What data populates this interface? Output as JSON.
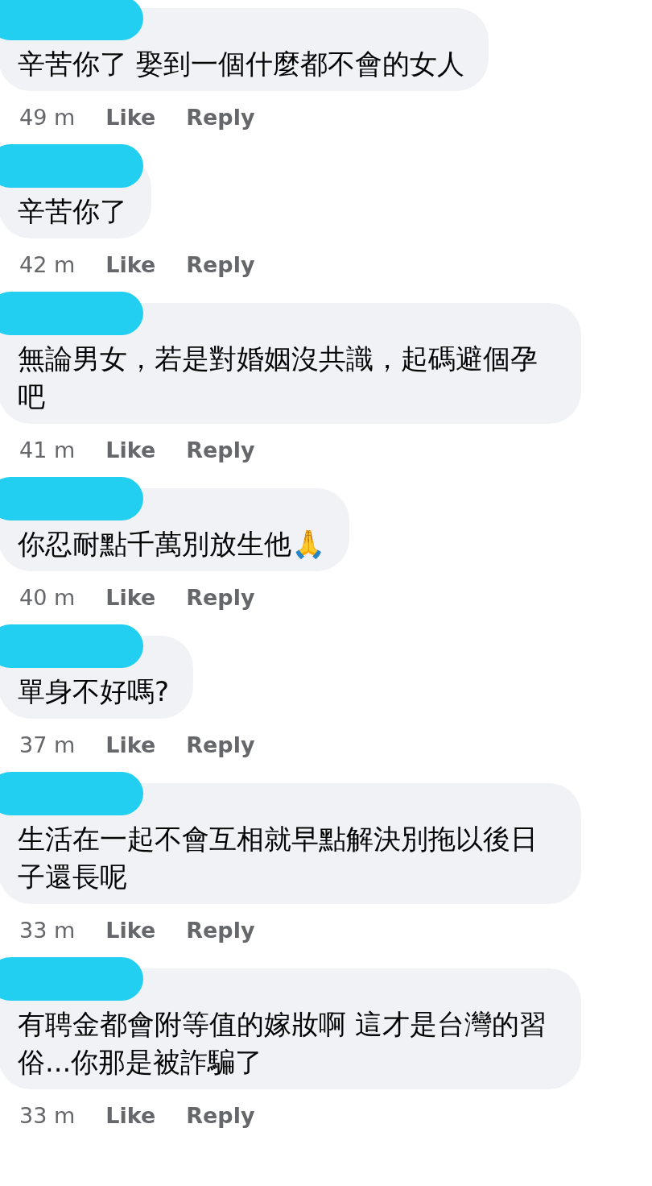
{
  "comments": [
    {
      "text": "辛苦你了 娶到一個什麼都不會的女人",
      "time": "49 m",
      "like": "Like",
      "reply": "Reply"
    },
    {
      "text": "辛苦你了",
      "time": "42 m",
      "like": "Like",
      "reply": "Reply"
    },
    {
      "text": "無論男女，若是對婚姻沒共識，起碼避個孕吧",
      "time": "41 m",
      "like": "Like",
      "reply": "Reply"
    },
    {
      "text": "你忍耐點千萬別放生他🙏",
      "time": "40 m",
      "like": "Like",
      "reply": "Reply"
    },
    {
      "text": "單身不好嗎?",
      "time": "37 m",
      "like": "Like",
      "reply": "Reply"
    },
    {
      "text": "生活在一起不會互相就早點解決別拖以後日子還長呢",
      "time": "33 m",
      "like": "Like",
      "reply": "Reply"
    },
    {
      "text": "有聘金都會附等值的嫁妝啊 這才是台灣的習俗...你那是被詐騙了",
      "time": "33 m",
      "like": "Like",
      "reply": "Reply"
    }
  ]
}
